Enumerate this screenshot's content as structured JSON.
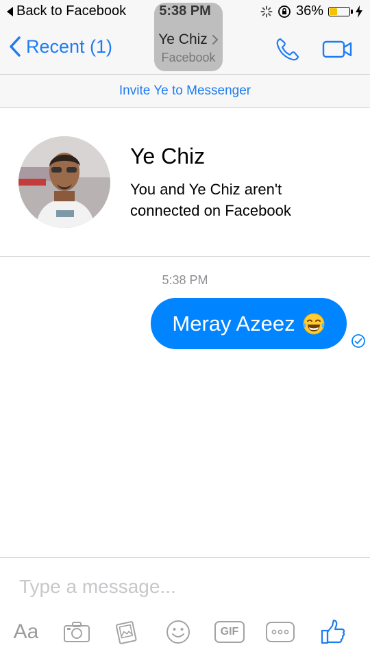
{
  "status_bar": {
    "back_label": "Back to Facebook",
    "time": "5:38 PM",
    "battery_percent": "36%",
    "battery_level": 0.36
  },
  "nav": {
    "back_label": "Recent (1)",
    "title": "Ye Chiz",
    "subtitle": "Facebook",
    "call_icon": "phone-icon",
    "video_icon": "video-camera-icon"
  },
  "invite": {
    "label": "Invite Ye to Messenger"
  },
  "profile": {
    "name": "Ye Chiz",
    "status": "You and Ye Chiz aren't connected on Facebook"
  },
  "conversation": {
    "timestamp": "5:38 PM",
    "messages": [
      {
        "text": "Meray Azeez",
        "emoji": "tears-of-joy-emoji",
        "sender": "me"
      }
    ]
  },
  "composer": {
    "placeholder": "Type a message...",
    "value": "",
    "tools": [
      {
        "name": "Aa",
        "icon": "text-format-icon"
      },
      {
        "name": "camera",
        "icon": "camera-icon"
      },
      {
        "name": "photos",
        "icon": "photo-icon"
      },
      {
        "name": "stickers",
        "icon": "smiley-icon"
      },
      {
        "name": "gif",
        "label": "GIF",
        "icon": "gif-icon"
      },
      {
        "name": "more",
        "icon": "more-icon"
      },
      {
        "name": "like",
        "icon": "thumbs-up-icon"
      }
    ]
  },
  "colors": {
    "accent": "#1e7cf2",
    "bubble": "#0084ff",
    "battery": "#f5c400",
    "toolbar_icon": "#a3a3a3"
  }
}
